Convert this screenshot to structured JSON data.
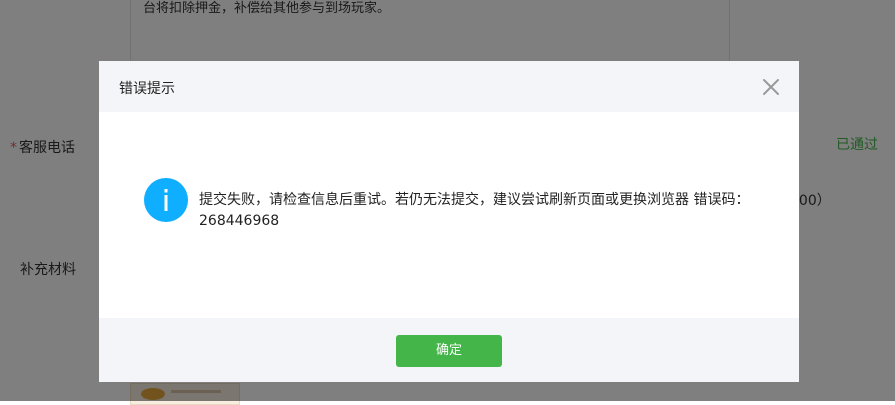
{
  "background": {
    "textarea_text": "台将扣除押金，补偿给其他参与到场玩家。",
    "phone_label": "客服电话",
    "required_mark": "*",
    "status_text": "已通过",
    "suffix_text": "000）",
    "supplement_label": "补充材料"
  },
  "dialog": {
    "title": "错误提示",
    "message": "提交失败，请检查信息后重试。若仍无法提交，建议尝试刷新页面或更换浏览器 错误码：268446968",
    "confirm_label": "确定",
    "icon": "info-icon",
    "close_icon": "close-icon"
  },
  "colors": {
    "accent_green": "#44b549",
    "info_blue": "#10aeff",
    "required_red": "#e15f63",
    "overlay": "rgba(0,0,0,0.5)"
  }
}
